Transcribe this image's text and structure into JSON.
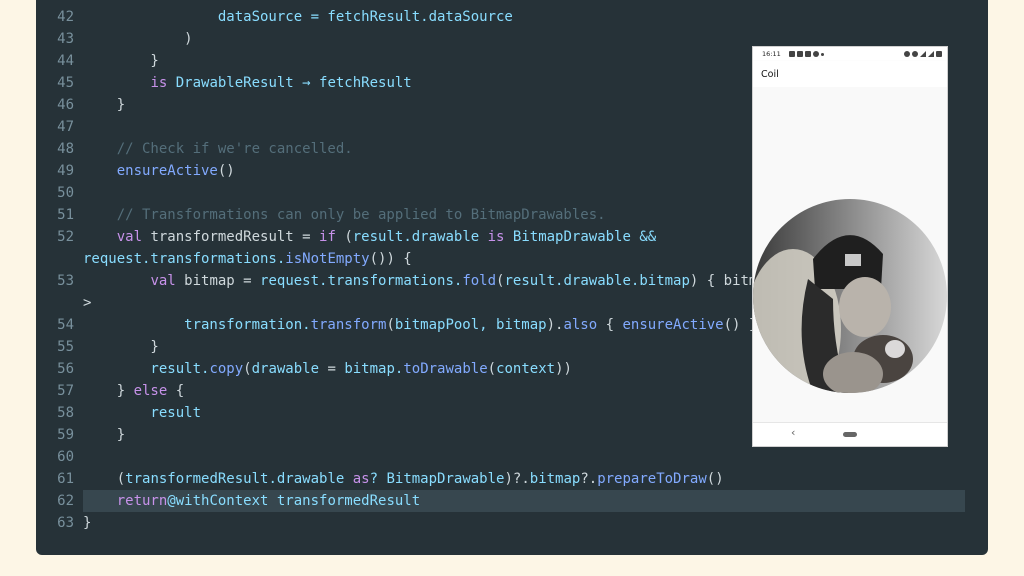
{
  "editor": {
    "lines": [
      {
        "num": "42",
        "tokens": [
          {
            "t": "                dataSource = fetchResult.dataSource",
            "c": "vr"
          }
        ]
      },
      {
        "num": "43",
        "tokens": [
          {
            "t": "            )",
            "c": "pn"
          }
        ]
      },
      {
        "num": "44",
        "tokens": [
          {
            "t": "        }",
            "c": "pn"
          }
        ]
      },
      {
        "num": "45",
        "tokens": [
          {
            "t": "        ",
            "c": "pn"
          },
          {
            "t": "is",
            "c": "kw"
          },
          {
            "t": " DrawableResult → fetchResult",
            "c": "vr"
          }
        ]
      },
      {
        "num": "46",
        "tokens": [
          {
            "t": "    }",
            "c": "pn"
          }
        ]
      },
      {
        "num": "47",
        "tokens": []
      },
      {
        "num": "48",
        "tokens": [
          {
            "t": "    // Check if we're cancelled.",
            "c": "cm"
          }
        ]
      },
      {
        "num": "49",
        "tokens": [
          {
            "t": "    ensureActive",
            "c": "fn"
          },
          {
            "t": "()",
            "c": "pn"
          }
        ]
      },
      {
        "num": "50",
        "tokens": []
      },
      {
        "num": "51",
        "tokens": [
          {
            "t": "    // Transformations can only be applied to BitmapDrawables.",
            "c": "cm"
          }
        ]
      },
      {
        "num": "52",
        "tokens": [
          {
            "t": "    ",
            "c": "pn"
          },
          {
            "t": "val",
            "c": "kw"
          },
          {
            "t": " transformedResult = ",
            "c": "pn"
          },
          {
            "t": "if",
            "c": "kw"
          },
          {
            "t": " (",
            "c": "pn"
          },
          {
            "t": "result.drawable",
            "c": "vr"
          },
          {
            "t": " is",
            "c": "kw"
          },
          {
            "t": " BitmapDrawable &&",
            "c": "vr"
          }
        ]
      },
      {
        "num": "",
        "tokens": [
          {
            "t": "request.transformations.",
            "c": "vr"
          },
          {
            "t": "isNotEmpty",
            "c": "fn"
          },
          {
            "t": "()) {",
            "c": "pn"
          }
        ]
      },
      {
        "num": "53",
        "tokens": [
          {
            "t": "        ",
            "c": "pn"
          },
          {
            "t": "val",
            "c": "kw"
          },
          {
            "t": " bitmap = ",
            "c": "pn"
          },
          {
            "t": "request.transformations.",
            "c": "vr"
          },
          {
            "t": "fold",
            "c": "fn"
          },
          {
            "t": "(",
            "c": "pn"
          },
          {
            "t": "result.drawable.bitmap",
            "c": "vr"
          },
          {
            "t": ") { bitmap, transformation -",
            "c": "pn"
          }
        ]
      },
      {
        "num": "",
        "tokens": [
          {
            "t": ">",
            "c": "pn"
          }
        ]
      },
      {
        "num": "54",
        "tokens": [
          {
            "t": "            transformation.",
            "c": "vr"
          },
          {
            "t": "transform",
            "c": "fn"
          },
          {
            "t": "(",
            "c": "pn"
          },
          {
            "t": "bitmapPool, bitmap",
            "c": "vr"
          },
          {
            "t": ").",
            "c": "pn"
          },
          {
            "t": "also",
            "c": "fn"
          },
          {
            "t": " { ",
            "c": "pn"
          },
          {
            "t": "ensureActive",
            "c": "fn"
          },
          {
            "t": "() }",
            "c": "pn"
          }
        ]
      },
      {
        "num": "55",
        "tokens": [
          {
            "t": "        }",
            "c": "pn"
          }
        ]
      },
      {
        "num": "56",
        "tokens": [
          {
            "t": "        result.",
            "c": "vr"
          },
          {
            "t": "copy",
            "c": "fn"
          },
          {
            "t": "(",
            "c": "pn"
          },
          {
            "t": "drawable",
            "c": "vr"
          },
          {
            "t": " = ",
            "c": "pn"
          },
          {
            "t": "bitmap.",
            "c": "vr"
          },
          {
            "t": "toDrawable",
            "c": "fn"
          },
          {
            "t": "(",
            "c": "pn"
          },
          {
            "t": "context",
            "c": "vr"
          },
          {
            "t": "))",
            "c": "pn"
          }
        ]
      },
      {
        "num": "57",
        "tokens": [
          {
            "t": "    } ",
            "c": "pn"
          },
          {
            "t": "else",
            "c": "kw"
          },
          {
            "t": " {",
            "c": "pn"
          }
        ]
      },
      {
        "num": "58",
        "tokens": [
          {
            "t": "        result",
            "c": "vr"
          }
        ]
      },
      {
        "num": "59",
        "tokens": [
          {
            "t": "    }",
            "c": "pn"
          }
        ]
      },
      {
        "num": "60",
        "tokens": []
      },
      {
        "num": "61",
        "tokens": [
          {
            "t": "    (",
            "c": "pn"
          },
          {
            "t": "transformedResult.drawable",
            "c": "vr"
          },
          {
            "t": " as",
            "c": "kw"
          },
          {
            "t": "? BitmapDrawable",
            "c": "vr"
          },
          {
            "t": ")?.",
            "c": "pn"
          },
          {
            "t": "bitmap",
            "c": "vr"
          },
          {
            "t": "?.",
            "c": "pn"
          },
          {
            "t": "prepareToDraw",
            "c": "fn"
          },
          {
            "t": "()",
            "c": "pn"
          }
        ]
      },
      {
        "num": "62",
        "highlight": true,
        "tokens": [
          {
            "t": "    ",
            "c": "pn"
          },
          {
            "t": "return",
            "c": "kw"
          },
          {
            "t": "@withContext transformedResult",
            "c": "vr"
          }
        ]
      },
      {
        "num": "63",
        "tokens": [
          {
            "t": "}",
            "c": "pn"
          }
        ]
      }
    ]
  },
  "phone": {
    "status": {
      "time": "16:11"
    },
    "app_title": "Coil"
  },
  "colors": {
    "page_bg": "#fdf6e6",
    "editor_bg": "#263238",
    "highlight_bg": "#37474f"
  }
}
